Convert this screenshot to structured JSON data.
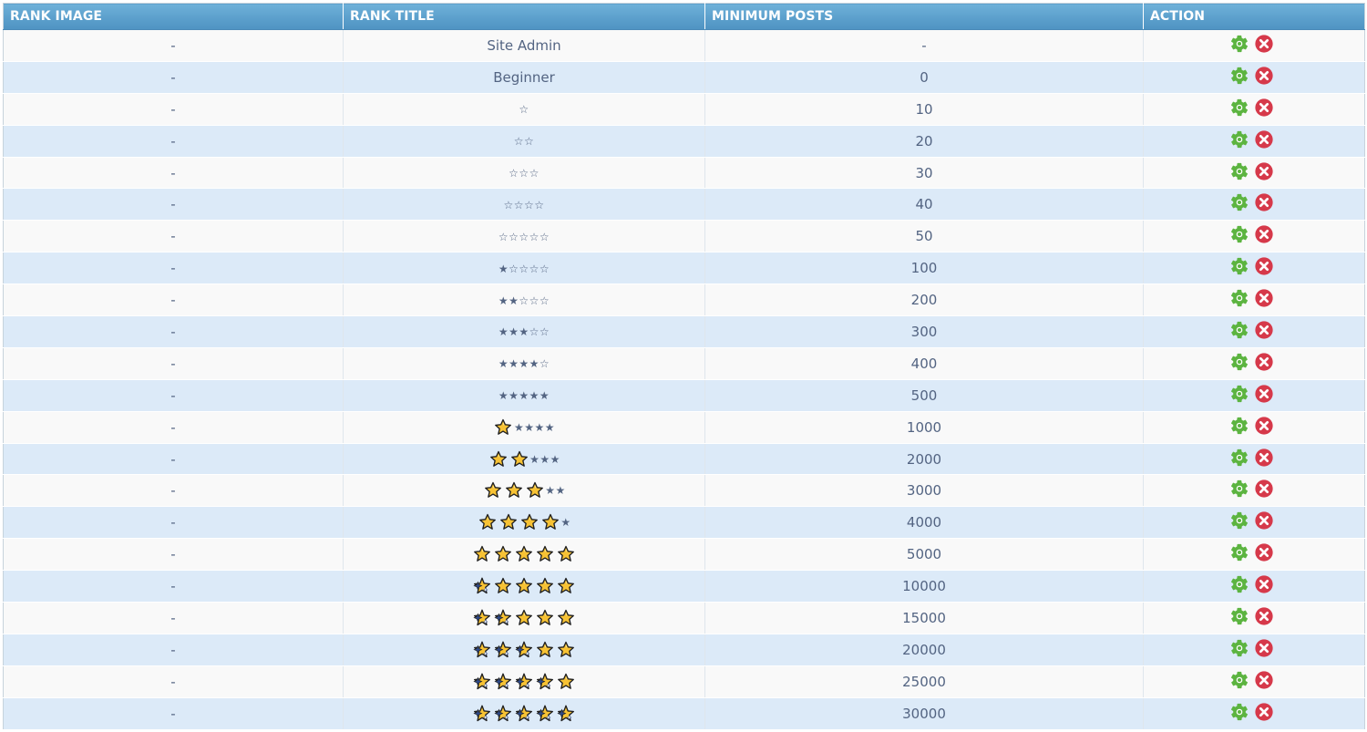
{
  "table": {
    "headers": {
      "rank_image": "RANK IMAGE",
      "rank_title": "RANK TITLE",
      "minimum_posts": "MINIMUM POSTS",
      "action": "ACTION"
    },
    "rows": [
      {
        "image": "-",
        "title": "Site Admin",
        "min_posts": "-",
        "gold_stars": 0,
        "sparkle_stars": 0
      },
      {
        "image": "-",
        "title": "Beginner",
        "min_posts": "0",
        "gold_stars": 0,
        "sparkle_stars": 0
      },
      {
        "image": "-",
        "title": "☆",
        "min_posts": "10",
        "gold_stars": 0,
        "sparkle_stars": 0
      },
      {
        "image": "-",
        "title": "☆☆",
        "min_posts": "20",
        "gold_stars": 0,
        "sparkle_stars": 0
      },
      {
        "image": "-",
        "title": "☆☆☆",
        "min_posts": "30",
        "gold_stars": 0,
        "sparkle_stars": 0
      },
      {
        "image": "-",
        "title": "☆☆☆☆",
        "min_posts": "40",
        "gold_stars": 0,
        "sparkle_stars": 0
      },
      {
        "image": "-",
        "title": "☆☆☆☆☆",
        "min_posts": "50",
        "gold_stars": 0,
        "sparkle_stars": 0
      },
      {
        "image": "-",
        "title": "★☆☆☆☆",
        "min_posts": "100",
        "gold_stars": 0,
        "sparkle_stars": 0
      },
      {
        "image": "-",
        "title": "★★☆☆☆",
        "min_posts": "200",
        "gold_stars": 0,
        "sparkle_stars": 0
      },
      {
        "image": "-",
        "title": "★★★☆☆",
        "min_posts": "300",
        "gold_stars": 0,
        "sparkle_stars": 0
      },
      {
        "image": "-",
        "title": "★★★★☆",
        "min_posts": "400",
        "gold_stars": 0,
        "sparkle_stars": 0
      },
      {
        "image": "-",
        "title": "★★★★★",
        "min_posts": "500",
        "gold_stars": 0,
        "sparkle_stars": 0
      },
      {
        "image": "-",
        "title": "★★★★",
        "min_posts": "1000",
        "gold_stars": 1,
        "sparkle_stars": 0
      },
      {
        "image": "-",
        "title": "★★★",
        "min_posts": "2000",
        "gold_stars": 2,
        "sparkle_stars": 0
      },
      {
        "image": "-",
        "title": "★★",
        "min_posts": "3000",
        "gold_stars": 3,
        "sparkle_stars": 0
      },
      {
        "image": "-",
        "title": "★",
        "min_posts": "4000",
        "gold_stars": 4,
        "sparkle_stars": 0
      },
      {
        "image": "-",
        "title": "",
        "min_posts": "5000",
        "gold_stars": 5,
        "sparkle_stars": 0
      },
      {
        "image": "-",
        "title": "",
        "min_posts": "10000",
        "gold_stars": 4,
        "sparkle_stars": 1
      },
      {
        "image": "-",
        "title": "",
        "min_posts": "15000",
        "gold_stars": 3,
        "sparkle_stars": 2
      },
      {
        "image": "-",
        "title": "",
        "min_posts": "20000",
        "gold_stars": 2,
        "sparkle_stars": 3
      },
      {
        "image": "-",
        "title": "",
        "min_posts": "25000",
        "gold_stars": 1,
        "sparkle_stars": 4
      },
      {
        "image": "-",
        "title": "",
        "min_posts": "30000",
        "gold_stars": 0,
        "sparkle_stars": 5
      }
    ]
  },
  "icons": {
    "edit": "gear-icon",
    "delete": "close-circle-icon",
    "gold_star": "gold-star-icon",
    "sparkle_star": "sparkle-star-icon"
  },
  "colors": {
    "header_bg": "#5a9ecb",
    "row_odd": "#f9f9f9",
    "row_even": "#dceaf8",
    "text": "#536482",
    "edit_icon": "#5cb440",
    "delete_icon": "#d6394a",
    "gold_star": "#f7c234"
  }
}
